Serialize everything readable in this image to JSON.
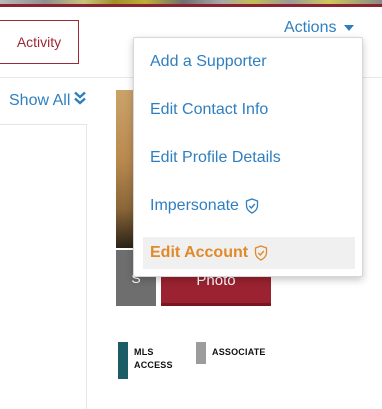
{
  "tabs": {
    "activity_label": "Activity"
  },
  "actions": {
    "label": "Actions"
  },
  "panel": {
    "show_all_label": "Show All"
  },
  "photo": {
    "grey_button_label": "S",
    "red_button_label": "Photo"
  },
  "badges": {
    "mls": {
      "line1": "MLS",
      "line2": "ACCESS"
    },
    "associate": {
      "label": "ASSOCIATE"
    }
  },
  "menu": {
    "items": [
      {
        "label": "Add a Supporter"
      },
      {
        "label": "Edit Contact Info"
      },
      {
        "label": "Edit Profile Details"
      },
      {
        "label": "Impersonate",
        "icon": "shield-check-icon"
      },
      {
        "label": "Edit Account",
        "icon": "shield-check-icon",
        "active": true
      }
    ]
  },
  "colors": {
    "link": "#2f7fc0",
    "brand_red": "#9b2231",
    "active_orange": "#e08a2a",
    "mls_teal": "#1b5c66",
    "associate_grey": "#9c9c9c"
  }
}
